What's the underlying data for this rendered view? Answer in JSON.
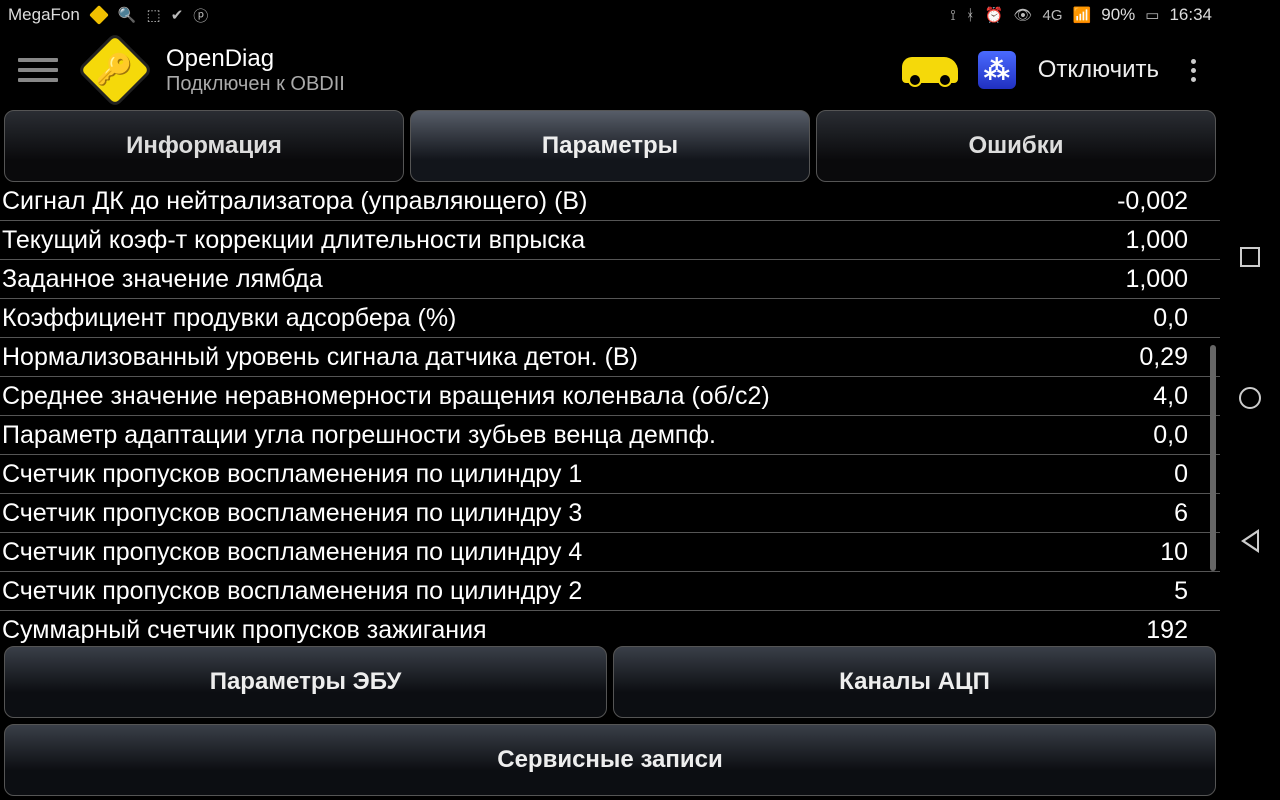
{
  "statusbar": {
    "carrier": "MegaFon",
    "battery": "90%",
    "time": "16:34",
    "network": "4G"
  },
  "appbar": {
    "title": "OpenDiag",
    "subtitle": "Подключен к OBDII",
    "disconnect": "Отключить"
  },
  "tabs": {
    "info": "Информация",
    "params": "Параметры",
    "errors": "Ошибки"
  },
  "parameters": [
    {
      "name": "Сигнал ДК до нейтрализатора (управляющего) (В)",
      "value": "-0,002"
    },
    {
      "name": "Текущий коэф-т коррекции длительности впрыска",
      "value": "1,000"
    },
    {
      "name": "Заданное значение лямбда",
      "value": "1,000"
    },
    {
      "name": "Коэффициент продувки адсорбера (%)",
      "value": "0,0"
    },
    {
      "name": "Нормализованный уровень сигнала датчика детон. (В)",
      "value": "0,29"
    },
    {
      "name": "Среднее значение неравномерности вращения коленвала (об/с2)",
      "value": "4,0"
    },
    {
      "name": "Параметр адаптации угла погрешности зубьев венца демпф.",
      "value": "0,0"
    },
    {
      "name": "Счетчик пропусков воспламенения по цилиндру 1",
      "value": "0"
    },
    {
      "name": "Счетчик пропусков воспламенения по цилиндру 3",
      "value": "6"
    },
    {
      "name": "Счетчик пропусков воспламенения по цилиндру 4",
      "value": "10"
    },
    {
      "name": "Счетчик пропусков воспламенения по цилиндру 2",
      "value": "5"
    },
    {
      "name": "Суммарный счетчик пропусков зажигания",
      "value": "192"
    }
  ],
  "bottom": {
    "ecu_params": "Параметры ЭБУ",
    "adc_channels": "Каналы АЦП",
    "service_records": "Сервисные записи"
  }
}
